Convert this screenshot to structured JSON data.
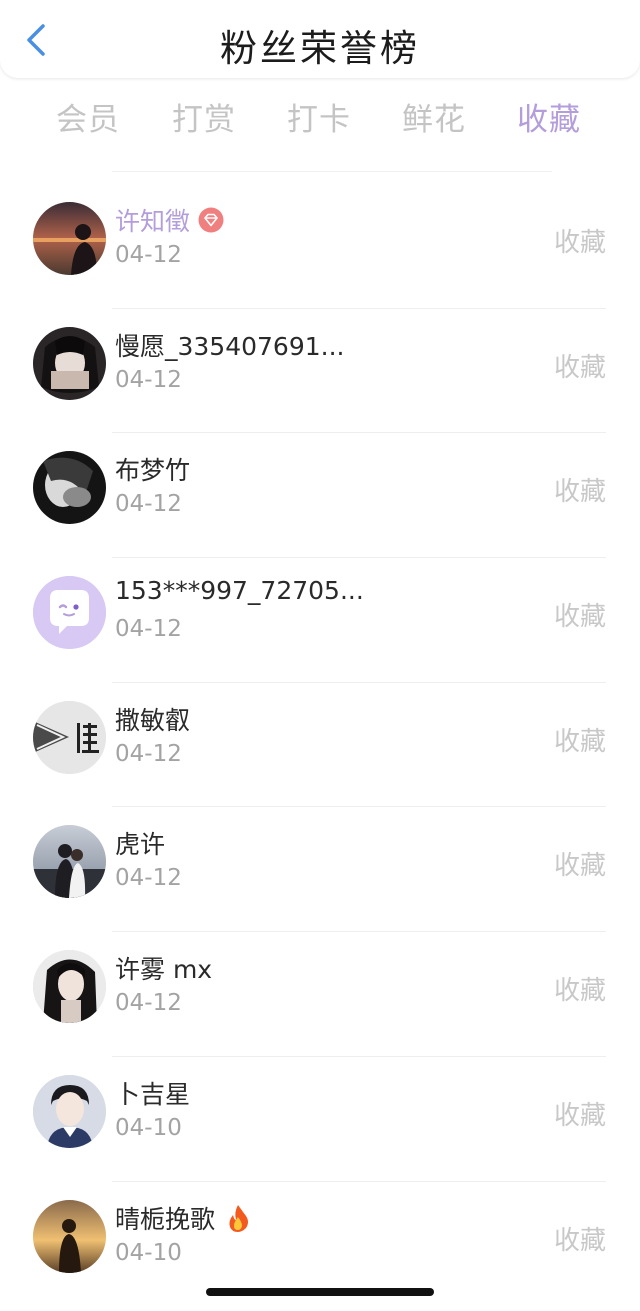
{
  "header": {
    "title": "粉丝荣誉榜",
    "back_icon": "chevron-left-icon"
  },
  "tabs": [
    {
      "label": "会员",
      "active": false
    },
    {
      "label": "打赏",
      "active": false
    },
    {
      "label": "打卡",
      "active": false
    },
    {
      "label": "鲜花",
      "active": false
    },
    {
      "label": "收藏",
      "active": true
    }
  ],
  "colors": {
    "accent": "#b39ddb",
    "back": "#4a90e2",
    "badge": "#f08080"
  },
  "fans": [
    {
      "name": "许知徵",
      "date": "04-12",
      "action": "收藏",
      "badge": "diamond-badge-icon"
    },
    {
      "name": "慢愿_335407691...",
      "date": "04-12",
      "action": "收藏"
    },
    {
      "name": "布梦竹",
      "date": "04-12",
      "action": "收藏"
    },
    {
      "name": "153***997_72705...",
      "date": "04-12",
      "action": "收藏"
    },
    {
      "name": "撒敏叡",
      "date": "04-12",
      "action": "收藏"
    },
    {
      "name": "虎许",
      "date": "04-12",
      "action": "收藏"
    },
    {
      "name": "许雾 mx",
      "date": "04-12",
      "action": "收藏"
    },
    {
      "name": "卜吉星",
      "date": "04-10",
      "action": "收藏"
    },
    {
      "name": "晴栀挽歌",
      "date": "04-10",
      "action": "收藏",
      "badge": "fire-emoji-icon"
    }
  ]
}
